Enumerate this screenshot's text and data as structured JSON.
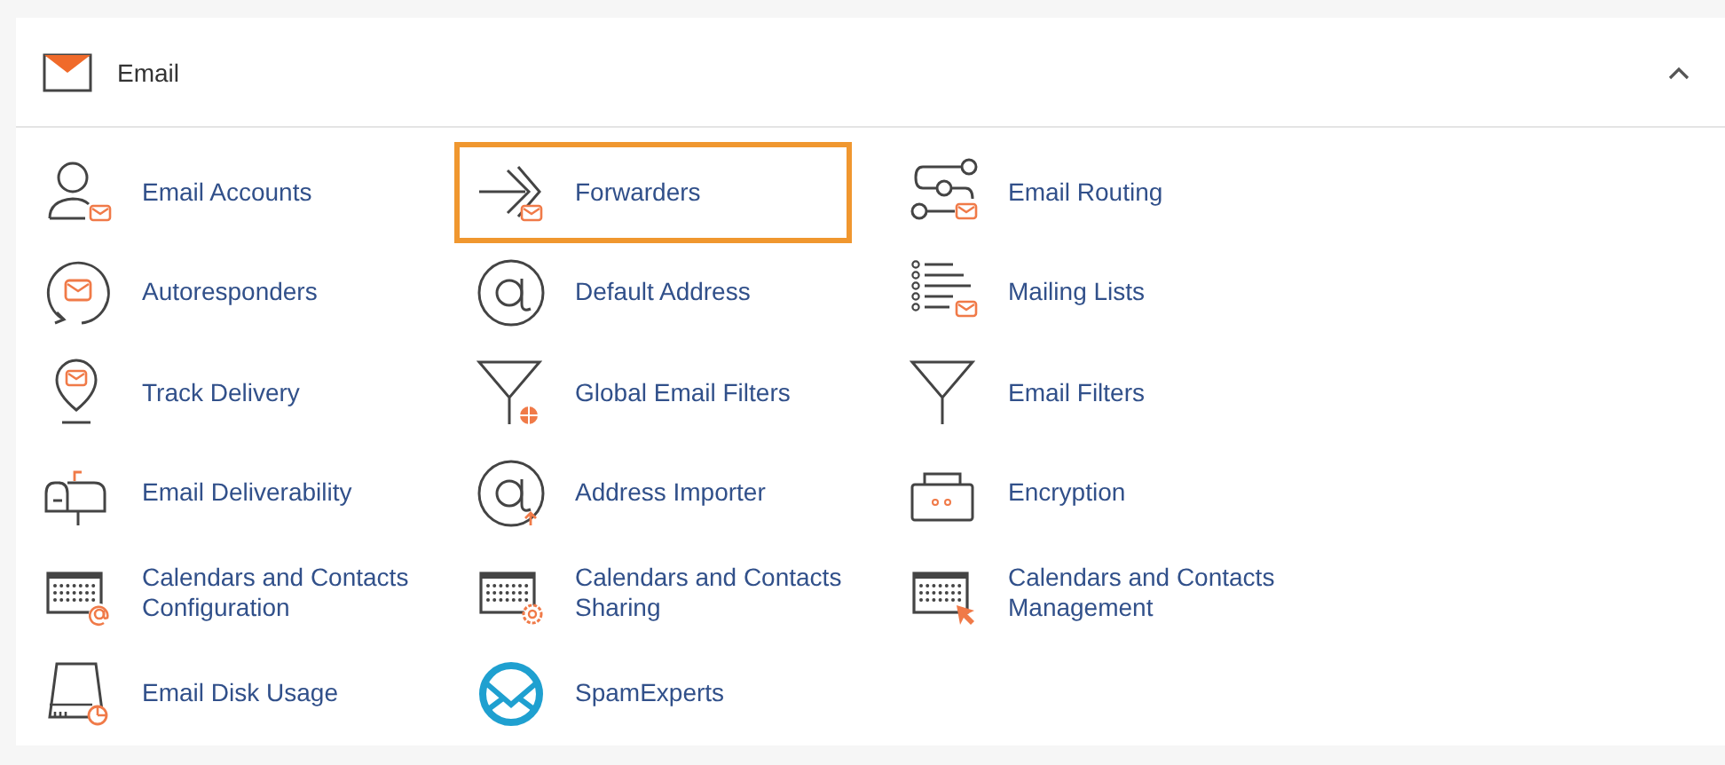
{
  "panel": {
    "title": "Email",
    "expanded": true
  },
  "items": [
    {
      "label": "Email Accounts",
      "highlighted": false
    },
    {
      "label": "Forwarders",
      "highlighted": true
    },
    {
      "label": "Email Routing",
      "highlighted": false
    },
    {
      "label": "Autoresponders",
      "highlighted": false
    },
    {
      "label": "Default Address",
      "highlighted": false
    },
    {
      "label": "Mailing Lists",
      "highlighted": false
    },
    {
      "label": "Track Delivery",
      "highlighted": false
    },
    {
      "label": "Global Email Filters",
      "highlighted": false
    },
    {
      "label": "Email Filters",
      "highlighted": false
    },
    {
      "label": "Email Deliverability",
      "highlighted": false
    },
    {
      "label": "Address Importer",
      "highlighted": false
    },
    {
      "label": "Encryption",
      "highlighted": false
    },
    {
      "label": "Calendars and Contacts Configuration",
      "highlighted": false
    },
    {
      "label": "Calendars and Contacts Sharing",
      "highlighted": false
    },
    {
      "label": "Calendars and Contacts Management",
      "highlighted": false
    },
    {
      "label": "Email Disk Usage",
      "highlighted": false
    },
    {
      "label": "SpamExperts",
      "highlighted": false
    }
  ]
}
